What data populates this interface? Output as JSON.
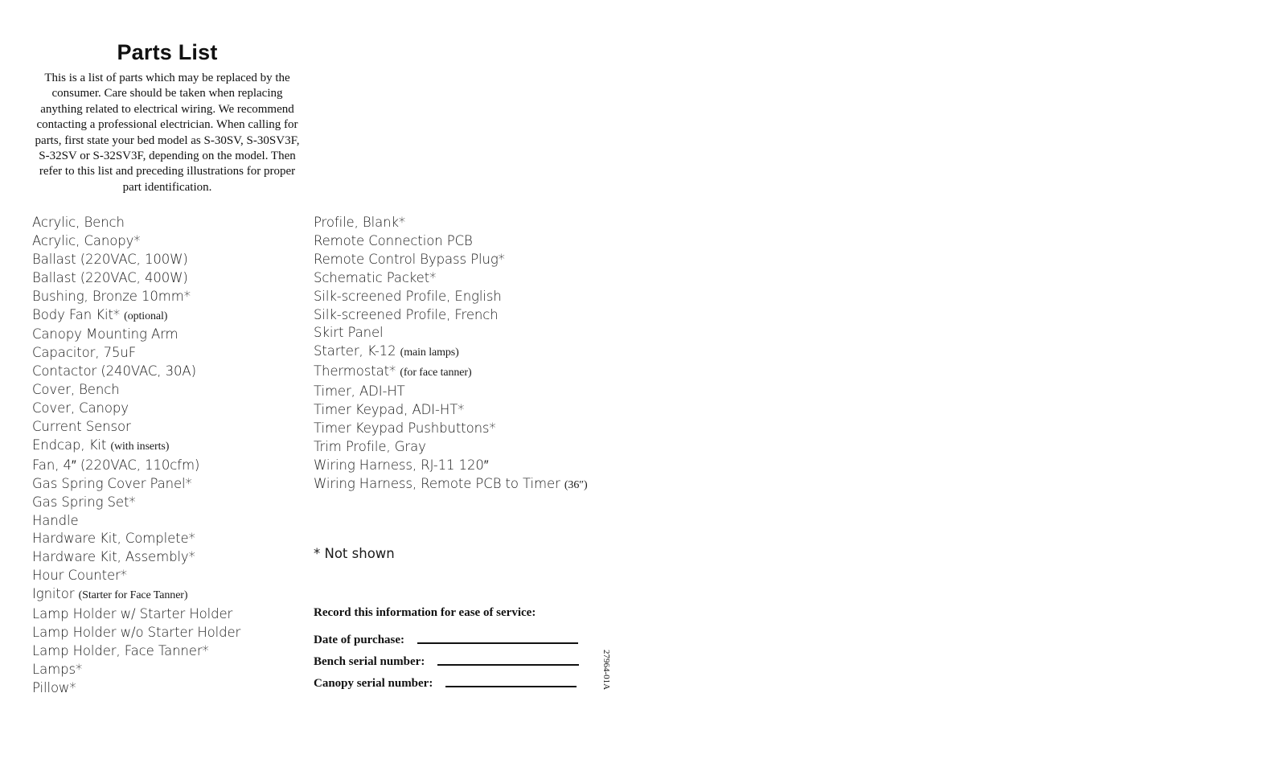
{
  "title": "Parts List",
  "intro": "This is a list of parts which may be replaced by the consumer. Care should be taken when replacing anything related to electrical wiring. We recommend contacting a professional electrician. When calling for parts, first state your bed model as S-30SV, S-30SV3F, S-32SV or S-32SV3F, depending on the model. Then refer to this list and preceding illustrations for proper part identification.",
  "parts_left": [
    {
      "name": "Acrylic, Bench",
      "note": ""
    },
    {
      "name": "Acrylic, Canopy*",
      "note": ""
    },
    {
      "name": "Ballast (220VAC, 100W)",
      "note": ""
    },
    {
      "name": "Ballast (220VAC, 400W)",
      "note": ""
    },
    {
      "name": "Bushing, Bronze 10mm*",
      "note": ""
    },
    {
      "name": "Body Fan Kit*",
      "note": "(optional)"
    },
    {
      "name": "Canopy Mounting Arm",
      "note": ""
    },
    {
      "name": "Capacitor, 75uF",
      "note": ""
    },
    {
      "name": "Contactor (240VAC, 30A)",
      "note": ""
    },
    {
      "name": "Cover, Bench",
      "note": ""
    },
    {
      "name": "Cover, Canopy",
      "note": ""
    },
    {
      "name": "Current Sensor",
      "note": ""
    },
    {
      "name": "Endcap, Kit",
      "note": "(with inserts)"
    },
    {
      "name": "Fan, 4″ (220VAC, 110cfm)",
      "note": ""
    },
    {
      "name": "Gas Spring Cover Panel*",
      "note": ""
    },
    {
      "name": "Gas Spring Set*",
      "note": ""
    },
    {
      "name": "Handle",
      "note": ""
    },
    {
      "name": "Hardware Kit, Complete*",
      "note": ""
    },
    {
      "name": "Hardware Kit, Assembly*",
      "note": ""
    },
    {
      "name": "Hour Counter*",
      "note": ""
    },
    {
      "name": "Ignitor",
      "note": "(Starter for Face Tanner)"
    },
    {
      "name": "Lamp Holder w/ Starter Holder",
      "note": ""
    },
    {
      "name": "Lamp Holder w/o Starter Holder",
      "note": ""
    },
    {
      "name": "Lamp Holder, Face Tanner*",
      "note": ""
    },
    {
      "name": "Lamps*",
      "note": ""
    },
    {
      "name": "Pillow*",
      "note": ""
    }
  ],
  "parts_right": [
    {
      "name": "Profile, Blank*",
      "note": ""
    },
    {
      "name": "Remote Connection PCB",
      "note": ""
    },
    {
      "name": "Remote Control Bypass Plug*",
      "note": ""
    },
    {
      "name": "Schematic Packet*",
      "note": ""
    },
    {
      "name": "Silk-screened Profile, English",
      "note": ""
    },
    {
      "name": "Silk-screened Profile, French",
      "note": ""
    },
    {
      "name": "Skirt Panel",
      "note": ""
    },
    {
      "name": "Starter, K-12",
      "note": "(main lamps)"
    },
    {
      "name": "Thermostat*",
      "note": "(for face tanner)"
    },
    {
      "name": "Timer, ADI-HT",
      "note": ""
    },
    {
      "name": "Timer Keypad, ADI-HT*",
      "note": ""
    },
    {
      "name": "Timer Keypad Pushbuttons*",
      "note": ""
    },
    {
      "name": "Trim Profile, Gray",
      "note": ""
    },
    {
      "name": "Wiring Harness, RJ-11 120″",
      "note": ""
    },
    {
      "name": "Wiring Harness, Remote PCB to Timer",
      "note": "(36″)"
    }
  ],
  "footnote": "* Not shown",
  "record": {
    "heading": "Record this information for ease of service:",
    "fields": [
      {
        "label": "Date of purchase:",
        "value": ""
      },
      {
        "label": "Bench serial number:",
        "value": ""
      },
      {
        "label": "Canopy serial number:",
        "value": ""
      }
    ]
  },
  "doc_number": "27964-01A"
}
